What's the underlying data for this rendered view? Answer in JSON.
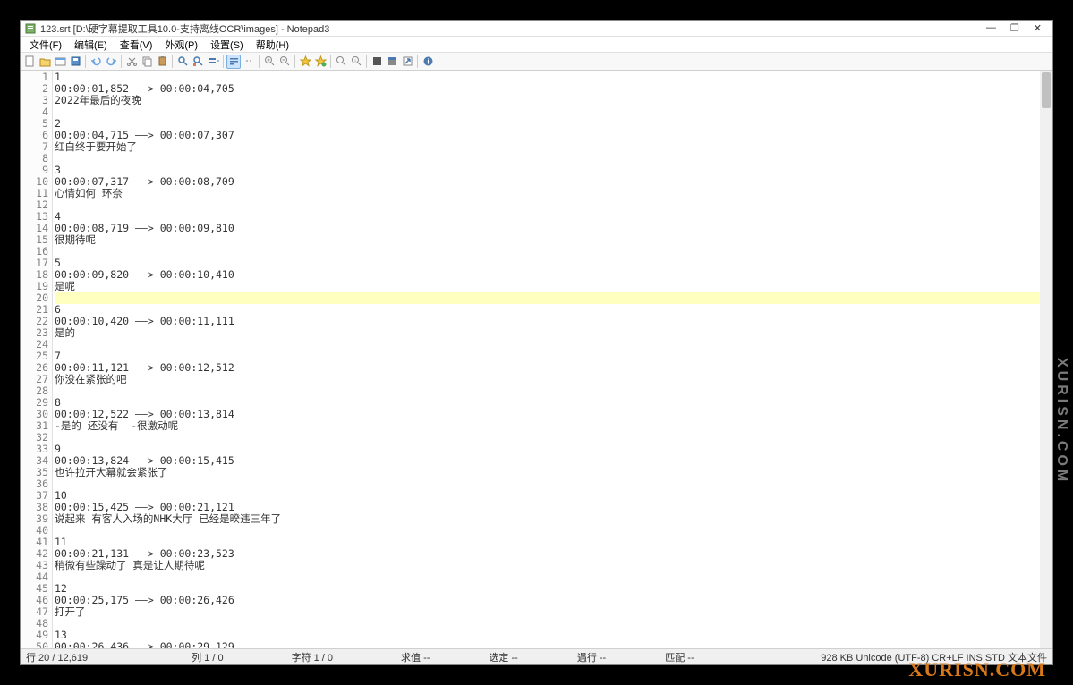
{
  "title": "123.srt [D:\\硬字幕提取工具10.0-支持离线OCR\\images] - Notepad3",
  "menus": [
    "文件(F)",
    "编辑(E)",
    "查看(V)",
    "外观(P)",
    "设置(S)",
    "帮助(H)"
  ],
  "lines": [
    "1",
    "00:00:01,852 ——> 00:00:04,705",
    "2022年最后的夜晚",
    "",
    "2",
    "00:00:04,715 ——> 00:00:07,307",
    "红白终于要开始了",
    "",
    "3",
    "00:00:07,317 ——> 00:00:08,709",
    "心情如何 环奈",
    "",
    "4",
    "00:00:08,719 ——> 00:00:09,810",
    "很期待呢",
    "",
    "5",
    "00:00:09,820 ——> 00:00:10,410",
    "是呢",
    "",
    "6",
    "00:00:10,420 ——> 00:00:11,111",
    "是的",
    "",
    "7",
    "00:00:11,121 ——> 00:00:12,512",
    "你没在紧张的吧",
    "",
    "8",
    "00:00:12,522 ——> 00:00:13,814",
    "-是的 还没有  -很激动呢",
    "",
    "9",
    "00:00:13,824 ——> 00:00:15,415",
    "也许拉开大幕就会紧张了",
    "",
    "10",
    "00:00:15,425 ——> 00:00:21,121",
    "说起来 有客人入场的NHK大厅 已经是暌违三年了",
    "",
    "11",
    "00:00:21,131 ——> 00:00:23,523",
    "稍微有些躁动了 真是让人期待呢",
    "",
    "12",
    "00:00:25,175 ——> 00:00:26,426",
    "打开了",
    "",
    "13",
    "00:00:26,436 ——> 00:00:29,129"
  ],
  "highlight_line": 20,
  "status": {
    "line_total": "行  20 / 12,619",
    "col": "列  1 / 0",
    "char": "字符  1 / 0",
    "val": "求值  --",
    "sel": "选定  --",
    "occ": "遇行  --",
    "match": "匹配  --",
    "fileinfo": "928 KB  Unicode (UTF-8)  CR+LF  INS  STD  文本文件"
  },
  "watermark_side": "XURISN.COM",
  "watermark_bottom": "XURISN.COM"
}
